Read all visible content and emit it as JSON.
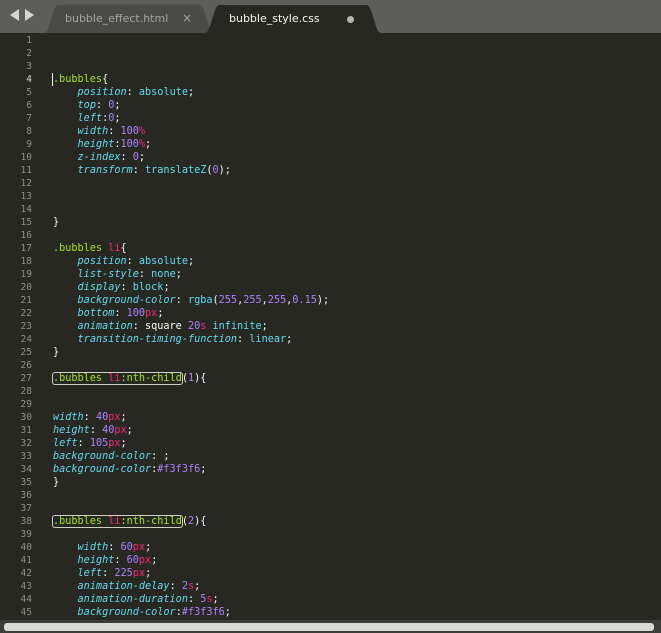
{
  "tabs": [
    {
      "label": "bubble_effect.html",
      "active": false,
      "close_glyph": "×"
    },
    {
      "label": "bubble_style.css",
      "active": true,
      "dirty": true
    }
  ],
  "nav": {
    "back_icon": "triangle-left-icon",
    "forward_icon": "triangle-right-icon"
  },
  "editor": {
    "current_line": 4,
    "lines": [
      {
        "n": "1",
        "tokens": []
      },
      {
        "n": "2",
        "tokens": []
      },
      {
        "n": "3",
        "tokens": []
      },
      {
        "n": "4",
        "tokens": [
          {
            "t": ".bubbles",
            "c": "sel"
          },
          {
            "t": "{",
            "c": "punc"
          }
        ]
      },
      {
        "n": "5",
        "tokens": [
          {
            "t": "    "
          },
          {
            "t": "position",
            "c": "prop"
          },
          {
            "t": ": "
          },
          {
            "t": "absolute",
            "c": "val"
          },
          {
            "t": ";"
          }
        ]
      },
      {
        "n": "6",
        "tokens": [
          {
            "t": "    "
          },
          {
            "t": "top",
            "c": "prop"
          },
          {
            "t": ": "
          },
          {
            "t": "0",
            "c": "num"
          },
          {
            "t": ";"
          }
        ]
      },
      {
        "n": "7",
        "tokens": [
          {
            "t": "    "
          },
          {
            "t": "left",
            "c": "prop"
          },
          {
            "t": ":"
          },
          {
            "t": "0",
            "c": "num"
          },
          {
            "t": ";"
          }
        ]
      },
      {
        "n": "8",
        "tokens": [
          {
            "t": "    "
          },
          {
            "t": "width",
            "c": "prop"
          },
          {
            "t": ": "
          },
          {
            "t": "100",
            "c": "num"
          },
          {
            "t": "%",
            "c": "unit"
          }
        ]
      },
      {
        "n": "9",
        "tokens": [
          {
            "t": "    "
          },
          {
            "t": "height",
            "c": "prop"
          },
          {
            "t": ":"
          },
          {
            "t": "100",
            "c": "num"
          },
          {
            "t": "%",
            "c": "unit"
          },
          {
            "t": ";"
          }
        ]
      },
      {
        "n": "10",
        "tokens": [
          {
            "t": "    "
          },
          {
            "t": "z-index",
            "c": "prop"
          },
          {
            "t": ": "
          },
          {
            "t": "0",
            "c": "num"
          },
          {
            "t": ";"
          }
        ]
      },
      {
        "n": "11",
        "tokens": [
          {
            "t": "    "
          },
          {
            "t": "transform",
            "c": "prop"
          },
          {
            "t": ": "
          },
          {
            "t": "translateZ",
            "c": "fn"
          },
          {
            "t": "("
          },
          {
            "t": "0",
            "c": "num"
          },
          {
            "t": ");"
          }
        ]
      },
      {
        "n": "12",
        "tokens": []
      },
      {
        "n": "13",
        "tokens": []
      },
      {
        "n": "14",
        "tokens": []
      },
      {
        "n": "15",
        "tokens": [
          {
            "t": "}"
          }
        ]
      },
      {
        "n": "16",
        "tokens": []
      },
      {
        "n": "17",
        "tokens": [
          {
            "t": ".bubbles",
            "c": "sel"
          },
          {
            "t": " "
          },
          {
            "t": "li",
            "c": "tag"
          },
          {
            "t": "{"
          }
        ]
      },
      {
        "n": "18",
        "tokens": [
          {
            "t": "    "
          },
          {
            "t": "position",
            "c": "prop"
          },
          {
            "t": ": "
          },
          {
            "t": "absolute",
            "c": "val"
          },
          {
            "t": ";"
          }
        ]
      },
      {
        "n": "19",
        "tokens": [
          {
            "t": "    "
          },
          {
            "t": "list-style",
            "c": "prop"
          },
          {
            "t": ": "
          },
          {
            "t": "none",
            "c": "val"
          },
          {
            "t": ";"
          }
        ]
      },
      {
        "n": "20",
        "tokens": [
          {
            "t": "    "
          },
          {
            "t": "display",
            "c": "prop"
          },
          {
            "t": ": "
          },
          {
            "t": "block",
            "c": "val"
          },
          {
            "t": ";"
          }
        ]
      },
      {
        "n": "21",
        "tokens": [
          {
            "t": "    "
          },
          {
            "t": "background-color",
            "c": "prop"
          },
          {
            "t": ": "
          },
          {
            "t": "rgba",
            "c": "fn"
          },
          {
            "t": "("
          },
          {
            "t": "255",
            "c": "num"
          },
          {
            "t": ","
          },
          {
            "t": "255",
            "c": "num"
          },
          {
            "t": ","
          },
          {
            "t": "255",
            "c": "num"
          },
          {
            "t": ","
          },
          {
            "t": "0.15",
            "c": "num"
          },
          {
            "t": ");"
          }
        ]
      },
      {
        "n": "22",
        "tokens": [
          {
            "t": "    "
          },
          {
            "t": "bottom",
            "c": "prop"
          },
          {
            "t": ": "
          },
          {
            "t": "100",
            "c": "num"
          },
          {
            "t": "px",
            "c": "unit"
          },
          {
            "t": ";"
          }
        ]
      },
      {
        "n": "23",
        "tokens": [
          {
            "t": "    "
          },
          {
            "t": "animation",
            "c": "prop"
          },
          {
            "t": ": square "
          },
          {
            "t": "20",
            "c": "num"
          },
          {
            "t": "s",
            "c": "unit"
          },
          {
            "t": " "
          },
          {
            "t": "infinite",
            "c": "val"
          },
          {
            "t": ";"
          }
        ]
      },
      {
        "n": "24",
        "tokens": [
          {
            "t": "    "
          },
          {
            "t": "transition-timing-function",
            "c": "prop"
          },
          {
            "t": ": "
          },
          {
            "t": "linear",
            "c": "val"
          },
          {
            "t": ";"
          }
        ]
      },
      {
        "n": "25",
        "tokens": [
          {
            "t": "}"
          }
        ]
      },
      {
        "n": "26",
        "tokens": []
      },
      {
        "n": "27",
        "tokens": [
          {
            "t": ".bubbles",
            "c": "sel",
            "hl": "start"
          },
          {
            "t": " "
          },
          {
            "t": "li",
            "c": "tag"
          },
          {
            "t": ":nth-child",
            "c": "sel",
            "hl": "end"
          },
          {
            "t": "("
          },
          {
            "t": "1",
            "c": "num"
          },
          {
            "t": "){"
          }
        ]
      },
      {
        "n": "28",
        "tokens": []
      },
      {
        "n": "29",
        "tokens": []
      },
      {
        "n": "30",
        "tokens": [
          {
            "t": "width",
            "c": "prop"
          },
          {
            "t": ": "
          },
          {
            "t": "40",
            "c": "num"
          },
          {
            "t": "px",
            "c": "unit"
          },
          {
            "t": ";"
          }
        ]
      },
      {
        "n": "31",
        "tokens": [
          {
            "t": "height",
            "c": "prop"
          },
          {
            "t": ": "
          },
          {
            "t": "40",
            "c": "num"
          },
          {
            "t": "px",
            "c": "unit"
          },
          {
            "t": ";"
          }
        ]
      },
      {
        "n": "32",
        "tokens": [
          {
            "t": "left",
            "c": "prop"
          },
          {
            "t": ": "
          },
          {
            "t": "105",
            "c": "num"
          },
          {
            "t": "px",
            "c": "unit"
          },
          {
            "t": ";"
          }
        ]
      },
      {
        "n": "33",
        "tokens": [
          {
            "t": "background-color",
            "c": "prop"
          },
          {
            "t": ": ;"
          }
        ]
      },
      {
        "n": "34",
        "tokens": [
          {
            "t": "background-color",
            "c": "prop"
          },
          {
            "t": ":"
          },
          {
            "t": "#f3f3f6",
            "c": "num"
          },
          {
            "t": ";"
          }
        ]
      },
      {
        "n": "35",
        "tokens": [
          {
            "t": "}"
          }
        ]
      },
      {
        "n": "36",
        "tokens": []
      },
      {
        "n": "37",
        "tokens": []
      },
      {
        "n": "38",
        "tokens": [
          {
            "t": ".bubbles",
            "c": "sel",
            "hl": "start"
          },
          {
            "t": " "
          },
          {
            "t": "li",
            "c": "tag"
          },
          {
            "t": ":nth-child",
            "c": "sel",
            "hl": "end"
          },
          {
            "t": "("
          },
          {
            "t": "2",
            "c": "num"
          },
          {
            "t": "){"
          }
        ]
      },
      {
        "n": "39",
        "tokens": []
      },
      {
        "n": "40",
        "tokens": [
          {
            "t": "    "
          },
          {
            "t": "width",
            "c": "prop"
          },
          {
            "t": ": "
          },
          {
            "t": "60",
            "c": "num"
          },
          {
            "t": "px",
            "c": "unit"
          },
          {
            "t": ";"
          }
        ]
      },
      {
        "n": "41",
        "tokens": [
          {
            "t": "    "
          },
          {
            "t": "height",
            "c": "prop"
          },
          {
            "t": ": "
          },
          {
            "t": "60",
            "c": "num"
          },
          {
            "t": "px",
            "c": "unit"
          },
          {
            "t": ";"
          }
        ]
      },
      {
        "n": "42",
        "tokens": [
          {
            "t": "    "
          },
          {
            "t": "left",
            "c": "prop"
          },
          {
            "t": ": "
          },
          {
            "t": "225",
            "c": "num"
          },
          {
            "t": "px",
            "c": "unit"
          },
          {
            "t": ";"
          }
        ]
      },
      {
        "n": "43",
        "tokens": [
          {
            "t": "    "
          },
          {
            "t": "animation-delay",
            "c": "prop"
          },
          {
            "t": ": "
          },
          {
            "t": "2",
            "c": "num"
          },
          {
            "t": "s",
            "c": "unit"
          },
          {
            "t": ";"
          }
        ]
      },
      {
        "n": "44",
        "tokens": [
          {
            "t": "    "
          },
          {
            "t": "animation-duration",
            "c": "prop"
          },
          {
            "t": ": "
          },
          {
            "t": "5",
            "c": "num"
          },
          {
            "t": "s",
            "c": "unit"
          },
          {
            "t": ";"
          }
        ]
      },
      {
        "n": "45",
        "tokens": [
          {
            "t": "    "
          },
          {
            "t": "background-color",
            "c": "prop"
          },
          {
            "t": ":"
          },
          {
            "t": "#f3f3f6",
            "c": "num"
          },
          {
            "t": ";"
          }
        ]
      }
    ]
  }
}
